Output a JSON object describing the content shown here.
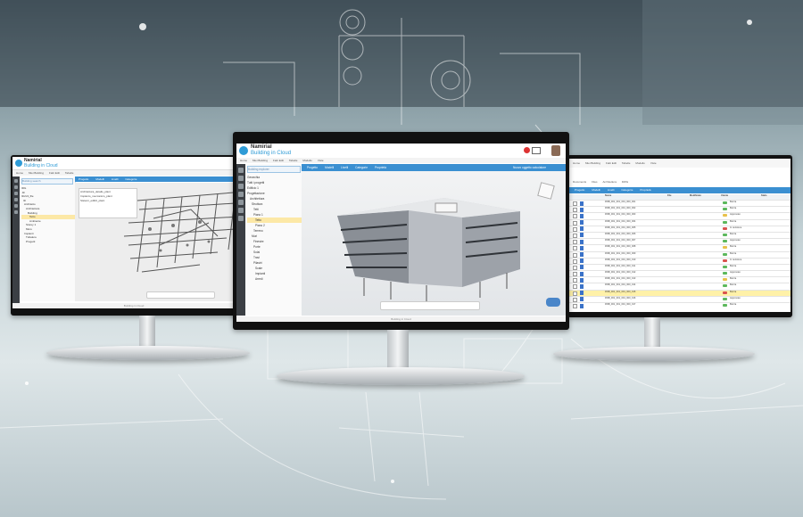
{
  "colors": {
    "accent": "#3a8fd1",
    "brand": "#2e9bd6",
    "selected": "#fce8a6",
    "highlight": "#fff1a8"
  },
  "app": {
    "brand_top": "Namirial",
    "brand_bottom": "Building in Cloud"
  },
  "left": {
    "search_placeholder": "Building search",
    "tree": [
      "IDG",
      ".Ifc",
      "Ifc2x3_file",
      "Ifc",
      "Architetto",
      "Architettura",
      "Building",
      "Tetto",
      "Ambiente",
      "Storey 1",
      "Muro",
      "Impianti",
      "Tubature",
      "Progetti"
    ],
    "list": [
      "Architettura_details_plant",
      "Impianto_meccanico_plant",
      "Sistemi_edilizi_plant"
    ]
  },
  "center": {
    "menu": [
      "Home",
      "Miei Building",
      "Fatti Edit",
      "Tabelle",
      "Modello",
      "Viste"
    ],
    "toolbar": [
      "Progetto",
      "Modelli",
      "Livelli",
      "Categorie",
      "Proprietà"
    ],
    "toolbar_right": "Nuovo oggetto calcolatore",
    "search_placeholder": "Building explorer",
    "tree": [
      "Gerarchia",
      "Tutti i progetti",
      "Edificio 1",
      "Progettazione",
      "Architettura",
      "Struttura",
      "Tetti",
      "Piano 1",
      "Piano 2",
      "Tetto",
      "Terreno",
      "Muri",
      "Finestre",
      "Porte",
      "Solai",
      "Travi",
      "Pilastri",
      "Scale",
      "Impianti",
      "Arredi"
    ],
    "footer": "Building in Cloud"
  },
  "right": {
    "tabs": [
      "Documents",
      "Files",
      "Architettura",
      "DWG"
    ],
    "columns": [
      "Nome",
      "File",
      "Modificato",
      "Utente",
      "Stato"
    ],
    "rows": [
      {
        "name": "RNB_001_001_001_000_001",
        "status": "Bozza"
      },
      {
        "name": "RNB_001_001_001_000_002",
        "status": "Bozza"
      },
      {
        "name": "RNB_001_001_001_000_003",
        "status": "Approvato"
      },
      {
        "name": "RNB_001_001_001_000_004",
        "status": "Bozza"
      },
      {
        "name": "RNB_001_001_001_000_005",
        "status": "In revisione"
      },
      {
        "name": "RNB_001_001_001_000_006",
        "status": "Bozza"
      },
      {
        "name": "RNB_001_001_001_000_007",
        "status": "Approvato"
      },
      {
        "name": "RNB_001_001_001_000_008",
        "status": "Bozza"
      },
      {
        "name": "RNB_001_001_001_000_009",
        "status": "Bozza"
      },
      {
        "name": "RNB_001_001_001_000_010",
        "status": "In revisione"
      },
      {
        "name": "RNB_001_001_001_000_011",
        "status": "Bozza"
      },
      {
        "name": "RNB_001_001_001_000_012",
        "status": "Approvato"
      },
      {
        "name": "RNB_001_001_001_000_013",
        "status": "Bozza"
      },
      {
        "name": "RNB_001_001_001_000_014",
        "status": "Bozza"
      },
      {
        "name": "RNB_001_001_001_000_015",
        "status": "Bozza"
      },
      {
        "name": "RNB_001_001_001_000_016",
        "status": "Approvato"
      },
      {
        "name": "RNB_001_001_001_000_017",
        "status": "Bozza"
      },
      {
        "name": "RNB_001_001_001_000_018",
        "status": "Bozza"
      },
      {
        "name": "RNB_001_001_001_000_019",
        "status": "Bozza"
      }
    ]
  }
}
